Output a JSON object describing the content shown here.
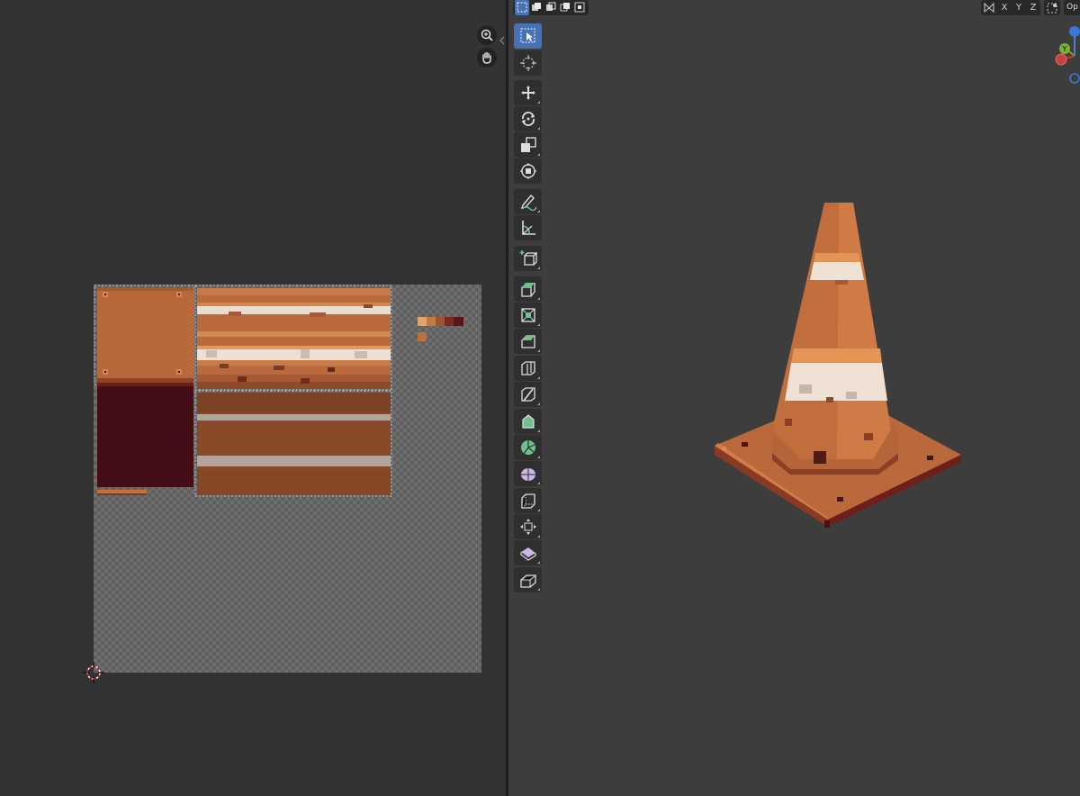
{
  "uv_editor": {
    "nav": [
      "zoom-icon",
      "pan-hand-icon"
    ]
  },
  "viewport": {
    "select_modes": [
      "select-box-new-icon",
      "select-extend-icon",
      "select-subtract-icon",
      "select-invert-icon",
      "select-intersect-icon"
    ],
    "axes": {
      "x": "X",
      "y": "Y",
      "z": "Z"
    },
    "options_label": "Op",
    "gizmo_axis_y": "Y"
  },
  "toolbar": {
    "tools": [
      "select-box",
      "cursor",
      "move",
      "rotate",
      "scale",
      "transform",
      "annotate",
      "measure",
      "add-cube",
      "extrude-region",
      "inset-faces",
      "bevel",
      "loop-cut",
      "knife",
      "poly-build",
      "spin",
      "smooth",
      "edge-slide",
      "shrink-fatten",
      "shear",
      "rip-region"
    ]
  },
  "colors": {
    "accent": "#4772b3",
    "cone_orange": "#c0693a",
    "stripe_white": "#efe2d4",
    "base_dark": "#7a2a1e"
  }
}
